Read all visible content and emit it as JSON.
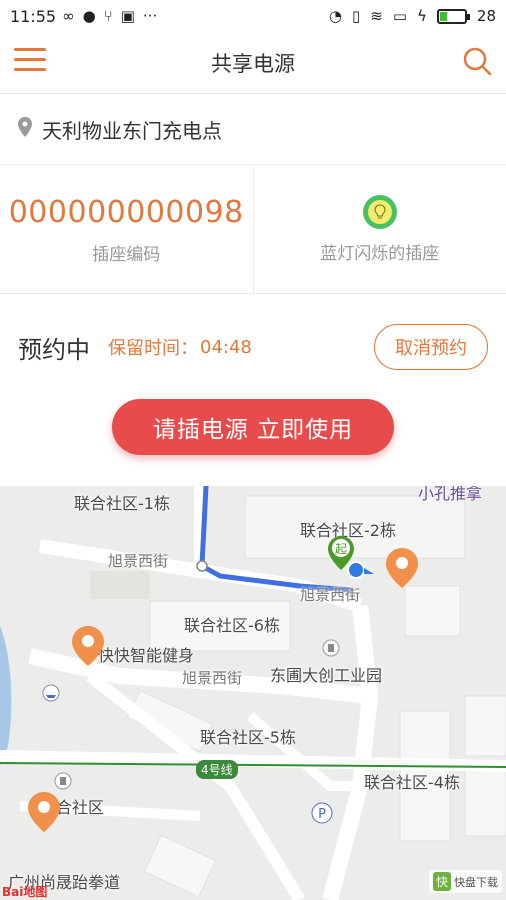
{
  "status_bar": {
    "time": "11:55",
    "battery": "28",
    "battery_level": 0.28
  },
  "header": {
    "title": "共享电源"
  },
  "location": {
    "name": "天利物业东门充电点"
  },
  "socket": {
    "code": "000000000098",
    "code_label": "插座编码",
    "indicator_label": "蓝灯闪烁的插座"
  },
  "reservation": {
    "status": "预约中",
    "time_label": "保留时间：",
    "time_value": "04:48",
    "cancel_label": "取消预约"
  },
  "use_button": {
    "label": "请插电源 立即使用"
  },
  "map": {
    "labels": {
      "lianhe_1": "联合社区-1栋",
      "lianhe_2": "联合社区-2栋",
      "lianhe_4": "联合社区-4栋",
      "lianhe_5": "联合社区-5栋",
      "lianhe_6": "联合社区-6栋",
      "xujing_1": "旭景西街",
      "xujing_2": "旭景西街",
      "xujing_3": "旭景西街",
      "kuaikuai": "快快智能健身",
      "dongyuan": "东圃大创工业园",
      "lianhe_community": "联合社区",
      "guangzhou": "广州尚晟跆拳道",
      "top_right": "小孔推拿",
      "metro": "4号线",
      "start_marker": "起",
      "parking": "P"
    },
    "baidu_logo": "Bai地图",
    "watermark": "快盘下载"
  }
}
